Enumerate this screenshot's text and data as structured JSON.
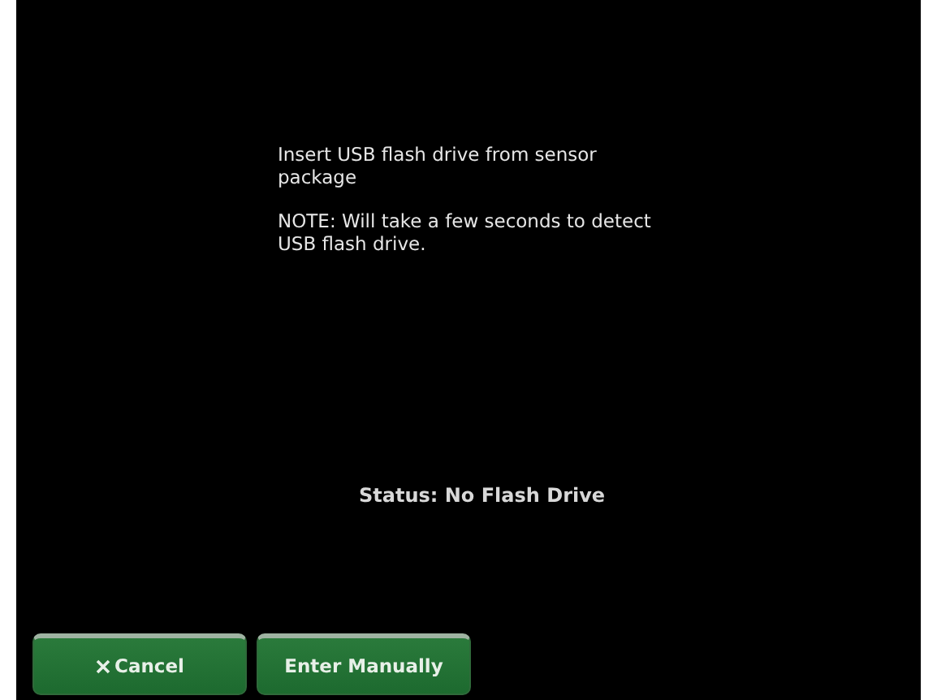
{
  "instructions": [
    "Insert USB flash drive from sensor package",
    "NOTE: Will take a few seconds to detect USB flash drive."
  ],
  "status": "Status: No Flash Drive",
  "buttons": [
    {
      "label": "Cancel",
      "kind": "cancel"
    },
    {
      "label": "Enter Manually",
      "kind": "plain"
    }
  ]
}
